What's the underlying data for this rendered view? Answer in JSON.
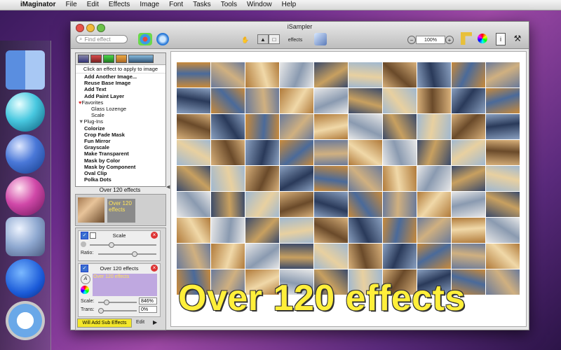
{
  "menubar": {
    "apple": "",
    "app": "iMaginator",
    "items": [
      "File",
      "Edit",
      "Effects",
      "Image",
      "Font",
      "Tasks",
      "Tools",
      "Window",
      "Help"
    ]
  },
  "window": {
    "title": "iSampler",
    "search_placeholder": "Find effect",
    "effects_popup": "effects",
    "zoom": "100%"
  },
  "list": {
    "hint": "Click an effect to apply to image",
    "items": [
      {
        "label": "Add Another Image...",
        "kind": "item"
      },
      {
        "label": "Reuse Base Image",
        "kind": "item"
      },
      {
        "label": "Add Text",
        "kind": "item"
      },
      {
        "label": "Add Paint Layer",
        "kind": "item"
      },
      {
        "label": "Favorites",
        "kind": "head"
      },
      {
        "label": "Glass Lozenge",
        "kind": "sub"
      },
      {
        "label": "Scale",
        "kind": "sub"
      },
      {
        "label": "Plug-Ins",
        "kind": "head"
      },
      {
        "label": "Colorize",
        "kind": "item"
      },
      {
        "label": "Crop Fade Mask",
        "kind": "item"
      },
      {
        "label": "Fun Mirror",
        "kind": "item"
      },
      {
        "label": "Grayscale",
        "kind": "item"
      },
      {
        "label": "Make Transparent",
        "kind": "item"
      },
      {
        "label": "Mask by Color",
        "kind": "item"
      },
      {
        "label": "Mask by Component",
        "kind": "item"
      },
      {
        "label": "Oval Clip",
        "kind": "item"
      },
      {
        "label": "Polka Dots",
        "kind": "item"
      }
    ],
    "count_label": "Over 120 effects",
    "preview_text": "Over 120 effects"
  },
  "stack": {
    "scale_card": {
      "title": "Scale",
      "ratio_label": "Ratio:"
    },
    "text_card": {
      "title": "Over 120 effects",
      "text": "Over 120 effects",
      "scale_label": "Scale:",
      "scale_value": "846%",
      "trans_label": "Trans:",
      "trans_value": "0%"
    },
    "add_sub": "Will Add Sub Effects",
    "edit": "Edit"
  },
  "canvas": {
    "overlay_text": "Over 120 effects",
    "rows": 9,
    "cols": 10
  }
}
